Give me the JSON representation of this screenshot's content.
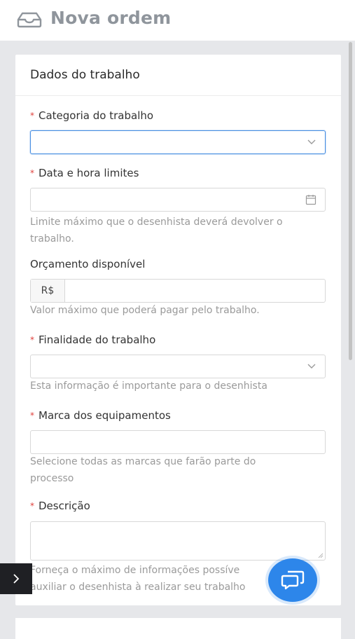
{
  "header": {
    "title": "Nova ordem",
    "icon": "inbox-tray-icon"
  },
  "card": {
    "title": "Dados do trabalho"
  },
  "form": {
    "categoria": {
      "label": "Categoria do trabalho",
      "required_mark": "*",
      "value": ""
    },
    "data": {
      "label": "Data e hora limites",
      "required_mark": "*",
      "value": "",
      "help_1": "Limite máximo que o desenhista deverá devolver o",
      "help_2": "trabalho."
    },
    "orcamento": {
      "label": "Orçamento disponível",
      "currency": "R$",
      "value": "",
      "help": "Valor máximo que poderá pagar pelo trabalho."
    },
    "finalidade": {
      "label": "Finalidade do trabalho",
      "required_mark": "*",
      "value": "",
      "help": "Esta informação é importante para o desenhista"
    },
    "marca": {
      "label": "Marca dos equipamentos",
      "required_mark": "*",
      "value": "",
      "help_1": "Selecione todas as marcas que farão parte do",
      "help_2": "processo"
    },
    "descricao": {
      "label": "Descrição",
      "required_mark": "*",
      "value": "",
      "help_1": "Forneça o máximo de informações possíve",
      "help_2": "auxiliar o desenhista à realizar seu trabalho"
    }
  },
  "colors": {
    "accent": "#2d86ea",
    "required": "#e0403c",
    "focus_border": "#4a90e2"
  }
}
